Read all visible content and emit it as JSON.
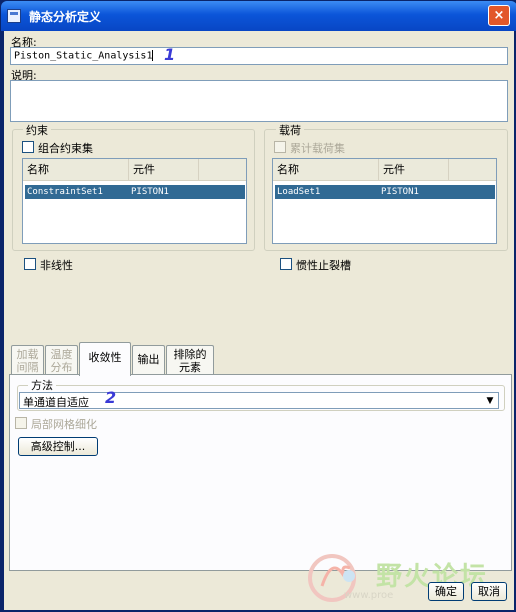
{
  "window": {
    "title": "静态分析定义",
    "close_label": "×"
  },
  "name": {
    "label": "名称:",
    "value": "Piston_Static_Analysis1",
    "annotation": "1"
  },
  "description": {
    "label": "说明:",
    "value": ""
  },
  "constraints": {
    "title": "约束",
    "combine_label": "组合约束集",
    "columns": [
      "名称",
      "元件"
    ],
    "rows": [
      [
        "ConstraintSet1",
        "PISTON1"
      ]
    ]
  },
  "loads": {
    "title": "载荷",
    "accumulate_label": "累计载荷集",
    "columns": [
      "名称",
      "元件"
    ],
    "rows": [
      [
        "LoadSet1",
        "PISTON1"
      ]
    ]
  },
  "options": {
    "nonlinear_label": "非线性",
    "inertia_relief_label": "惯性止裂槽"
  },
  "tabs": [
    {
      "label_line1": "加载",
      "label_line2": "间隔",
      "state": "disabled"
    },
    {
      "label_line1": "温度",
      "label_line2": "分布",
      "state": "disabled"
    },
    {
      "label_line1": "收敛性",
      "label_line2": "",
      "state": "active"
    },
    {
      "label_line1": "输出",
      "label_line2": "",
      "state": "normal"
    },
    {
      "label_line1": "排除的",
      "label_line2": "元素",
      "state": "normal"
    }
  ],
  "convergence": {
    "method_title": "方法",
    "method_value": "单通道自适应",
    "annotation": "2",
    "local_refine_label": "局部网格细化",
    "advanced_button": "高级控制..."
  },
  "watermark": {
    "text": "野火论坛",
    "url": "www.proe"
  },
  "buttons": {
    "ok": "确定",
    "cancel": "取消"
  },
  "colors": {
    "title_bar": "#0b55d9",
    "selection": "#316a94",
    "dialog_bg": "#ece9d8"
  }
}
